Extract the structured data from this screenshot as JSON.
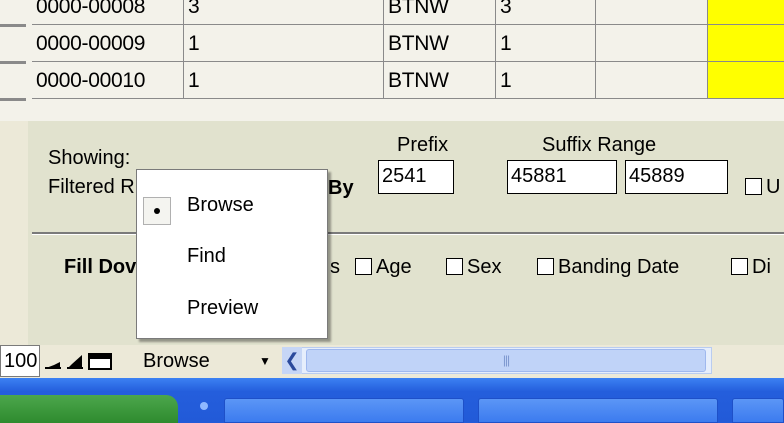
{
  "table": {
    "rows": [
      {
        "id": "0000-00008",
        "count": "3",
        "code": "BTNW",
        "qty": "3"
      },
      {
        "id": "0000-00009",
        "count": "1",
        "code": "BTNW",
        "qty": "1"
      },
      {
        "id": "0000-00010",
        "count": "1",
        "code": "BTNW",
        "qty": "1"
      }
    ]
  },
  "form": {
    "showing_label": "Showing:",
    "filtered_label": "Filtered R",
    "by_label": "By",
    "prefix_label": "Prefix",
    "prefix_value": "2541",
    "suffix_range_label": "Suffix Range",
    "suffix_from": "45881",
    "suffix_to": "45889",
    "trailing_checkbox_label": "U",
    "fill_down_label": "Fill Dov",
    "partial_label": "s",
    "checkboxes": [
      "Age",
      "Sex",
      "Banding Date",
      "Di"
    ]
  },
  "menu": {
    "items": [
      "Browse",
      "Find",
      "Preview"
    ],
    "selected": "Browse"
  },
  "statusbar": {
    "record_count": "100",
    "mode": "Browse"
  },
  "colors": {
    "highlight_cell": "#FFFF00",
    "panel": "#E1E2CE",
    "taskbar": "#245EDC"
  }
}
